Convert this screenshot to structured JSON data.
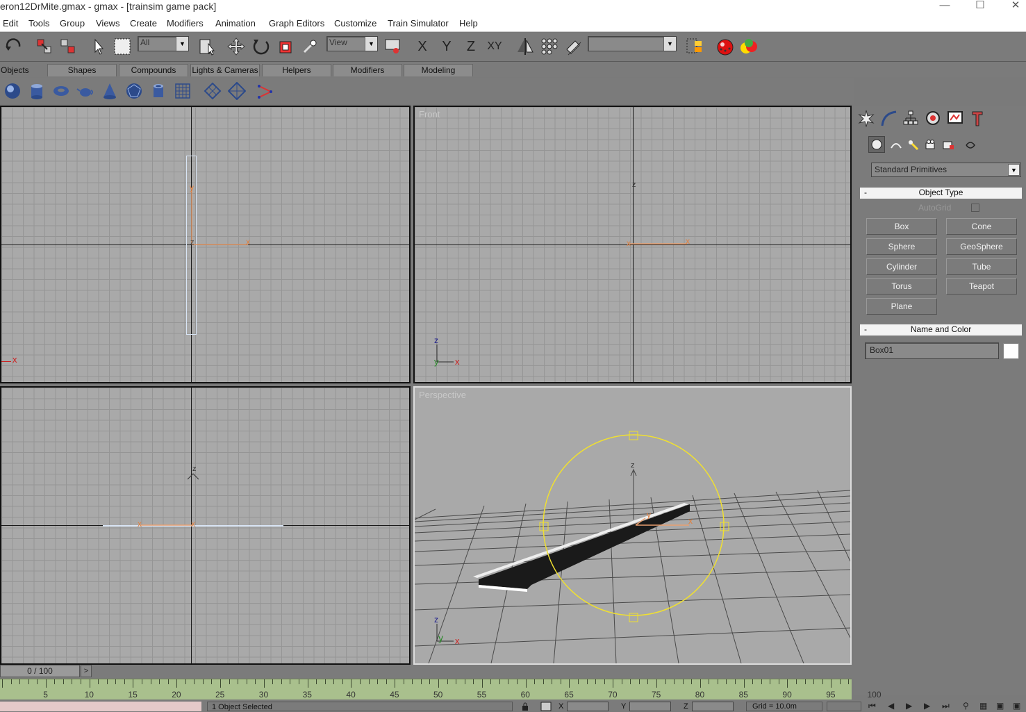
{
  "window": {
    "title": "eron12DrMite.gmax - gmax - [trainsim game pack]"
  },
  "menu": [
    "Edit",
    "Tools",
    "Group",
    "Views",
    "Create",
    "Modifiers",
    "Animation",
    "Graph Editors",
    "Customize",
    "Train Simulator",
    "Help"
  ],
  "toolbar": {
    "selection_filter": "All",
    "reference_coord": "View",
    "constraint_x": "X",
    "constraint_y": "Y",
    "constraint_z": "Z",
    "constraint_xy": "XY",
    "named_selection": ""
  },
  "tabs": [
    "Objects",
    "Shapes",
    "Compounds",
    "Lights & Cameras",
    "Helpers",
    "Modifiers",
    "Modeling"
  ],
  "active_tab": "Objects",
  "viewports": {
    "top_left": {
      "label": ""
    },
    "front": {
      "label": "Front"
    },
    "bottom_left": {
      "label": ""
    },
    "perspective": {
      "label": "Perspective"
    }
  },
  "axis_labels": {
    "x": "x",
    "y": "y",
    "z": "z"
  },
  "command_panel": {
    "category_dropdown": "Standard Primitives",
    "object_type": {
      "header": "Object Type",
      "collapse": "-",
      "autogrid_label": "AutoGrid",
      "buttons": [
        "Box",
        "Cone",
        "Sphere",
        "GeoSphere",
        "Cylinder",
        "Tube",
        "Torus",
        "Teapot",
        "Plane"
      ]
    },
    "name_and_color": {
      "header": "Name and Color",
      "collapse": "-",
      "name_value": "Box01",
      "color": "#ffffff"
    }
  },
  "time": {
    "slider_text": "0 / 100",
    "next": ">",
    "ticks": [
      "5",
      "10",
      "15",
      "20",
      "25",
      "30",
      "35",
      "40",
      "45",
      "50",
      "55",
      "60",
      "65",
      "70",
      "75",
      "80",
      "85",
      "90",
      "95",
      "100"
    ]
  },
  "status": {
    "selected": "1 Object Selected",
    "x_label": "X",
    "y_label": "Y",
    "z_label": "Z",
    "grid": "Grid = 10.0m"
  }
}
